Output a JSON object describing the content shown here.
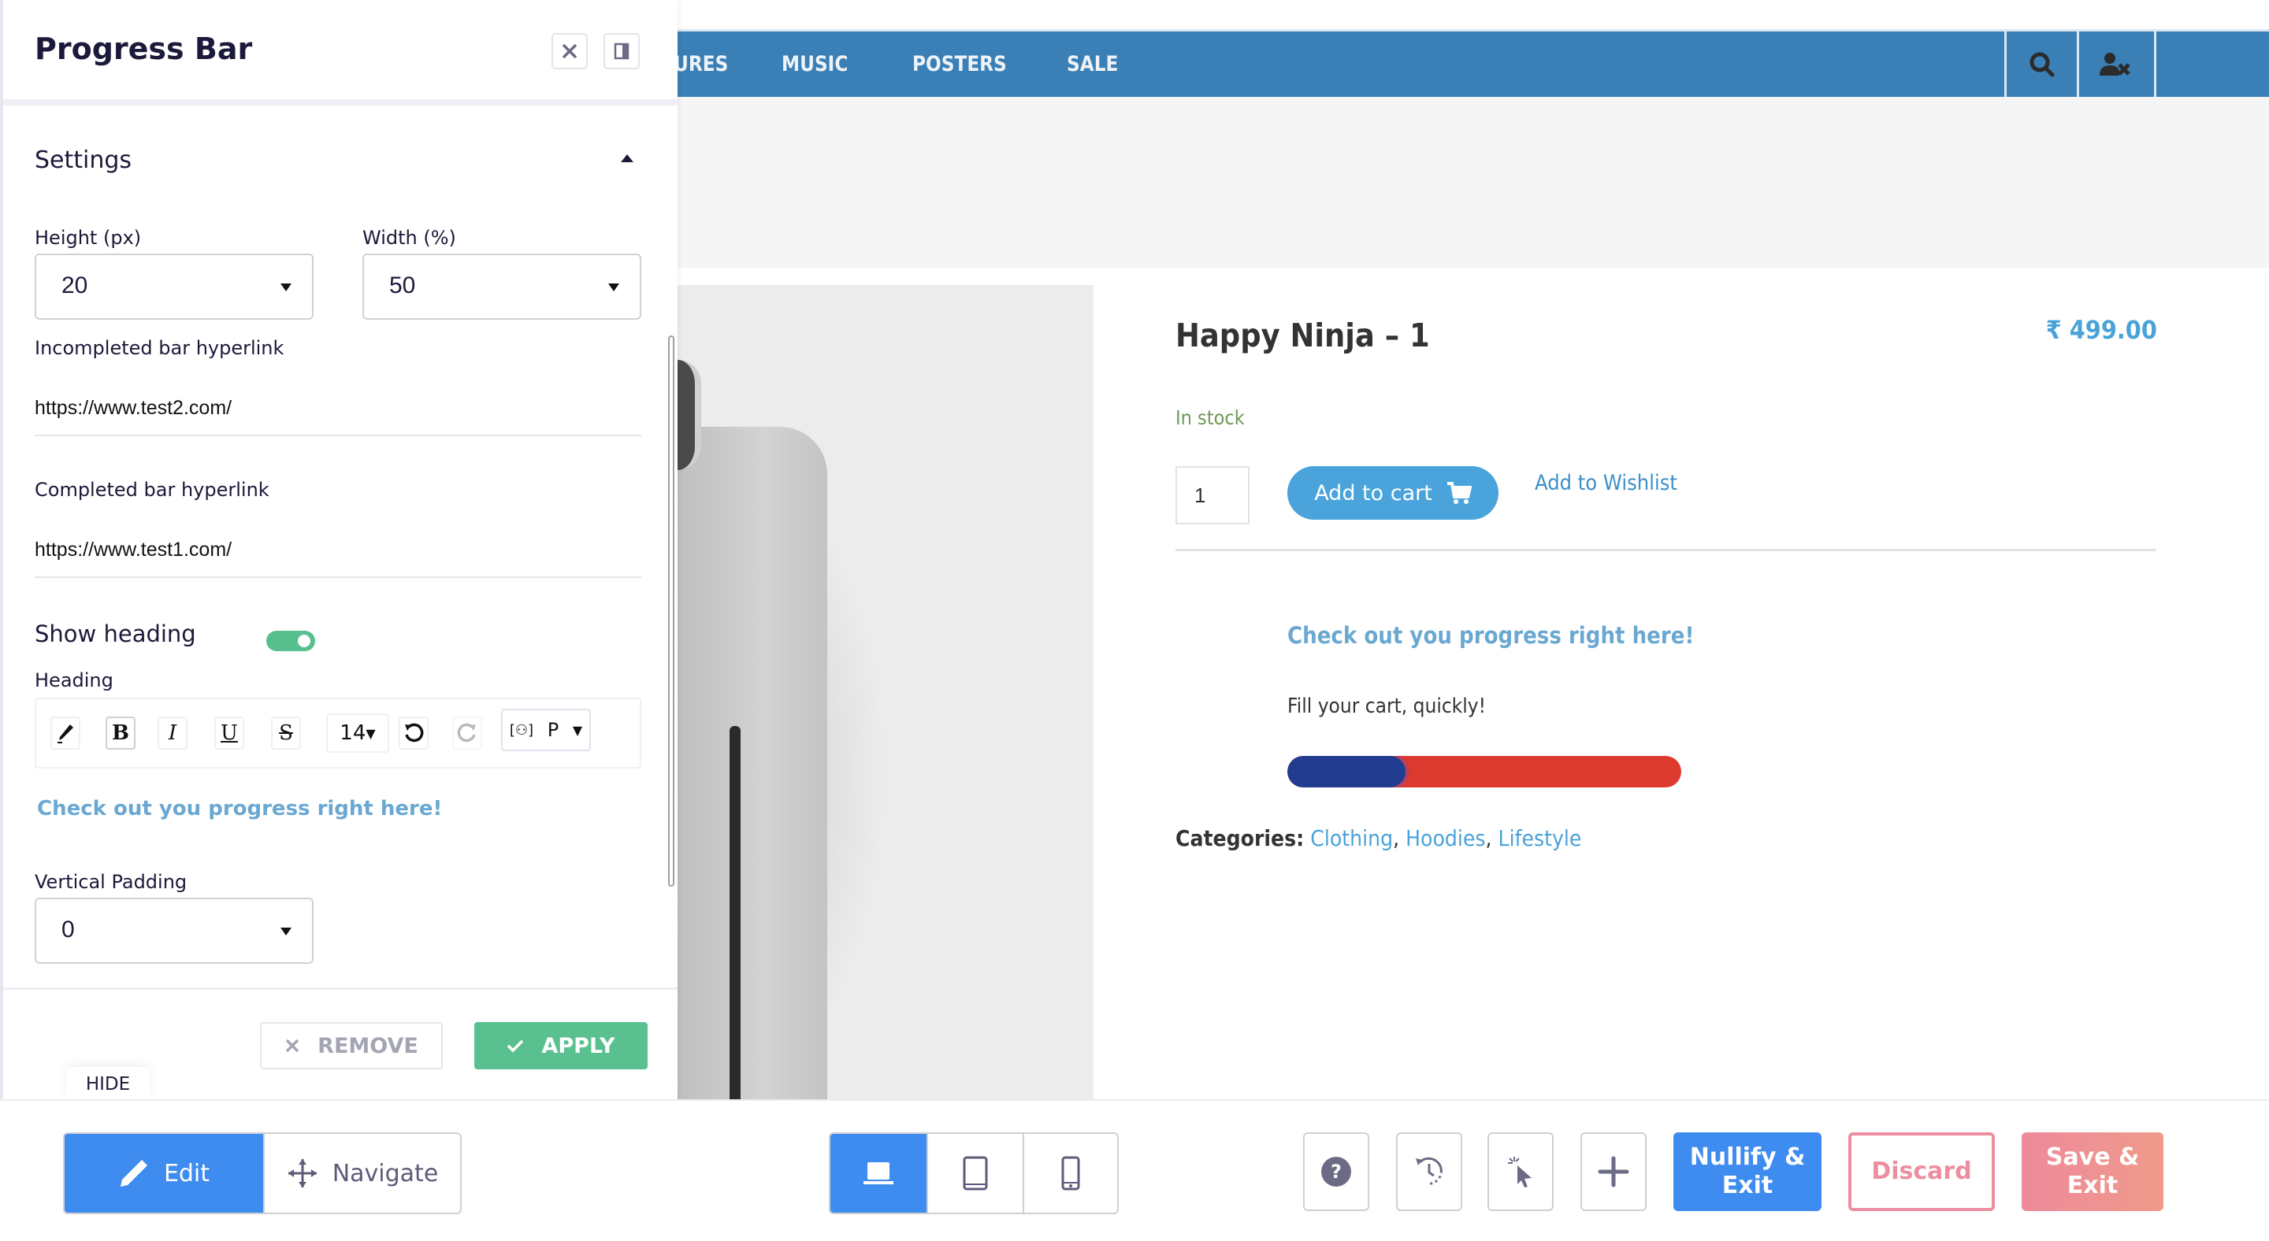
{
  "site": {
    "nav": {
      "items": [
        "URES",
        "MUSIC",
        "POSTERS",
        "SALE"
      ],
      "icons": [
        "search-icon",
        "user-remove-icon"
      ]
    },
    "product": {
      "title": "Happy Ninja – 1",
      "price": "₹ 499.00",
      "stock": "In stock",
      "quantity": "1",
      "add_to_cart": "Add to cart",
      "wishlist": "Add to Wishlist",
      "categories_label": "Categories:",
      "categories": [
        "Clothing",
        "Hoodies",
        "Lifestyle"
      ],
      "category_separator": ", "
    },
    "progress_widget": {
      "heading": "Check out you progress right here!",
      "subtext": "Fill your cart, quickly!",
      "progress_fraction": 0.3,
      "completed_color": "#223d8f",
      "incomplete_color": "#dc3a2e"
    }
  },
  "sidebar": {
    "title": "Progress Bar",
    "close_icon": "close-icon",
    "dock_icon": "dock-panel-icon",
    "section_title": "Settings",
    "height_label": "Height (px)",
    "height_value": "20",
    "width_label": "Width (%)",
    "width_value": "50",
    "incomplete_link_label": "Incompleted bar hyperlink",
    "incomplete_link_value": "https://www.test2.com/",
    "complete_link_label": "Completed bar hyperlink",
    "complete_link_value": "https://www.test1.com/",
    "show_heading_label": "Show heading",
    "show_heading_on": true,
    "heading_label": "Heading",
    "editor_font_size": "14",
    "editor_block": "P",
    "heading_preview": "Check out you progress right here!",
    "vpad_label": "Vertical Padding",
    "vpad_value": "0",
    "remove_label": "REMOVE",
    "apply_label": "APPLY",
    "hide_label": "HIDE",
    "accent_color": "#5ac08f"
  },
  "toolbar": {
    "edit_label": "Edit",
    "navigate_label": "Navigate",
    "nullify_label": "Nullify & Exit",
    "discard_label": "Discard",
    "save_label": "Save & Exit",
    "primary_color": "#3f8cf0",
    "danger_color": "#ec8ea0"
  }
}
